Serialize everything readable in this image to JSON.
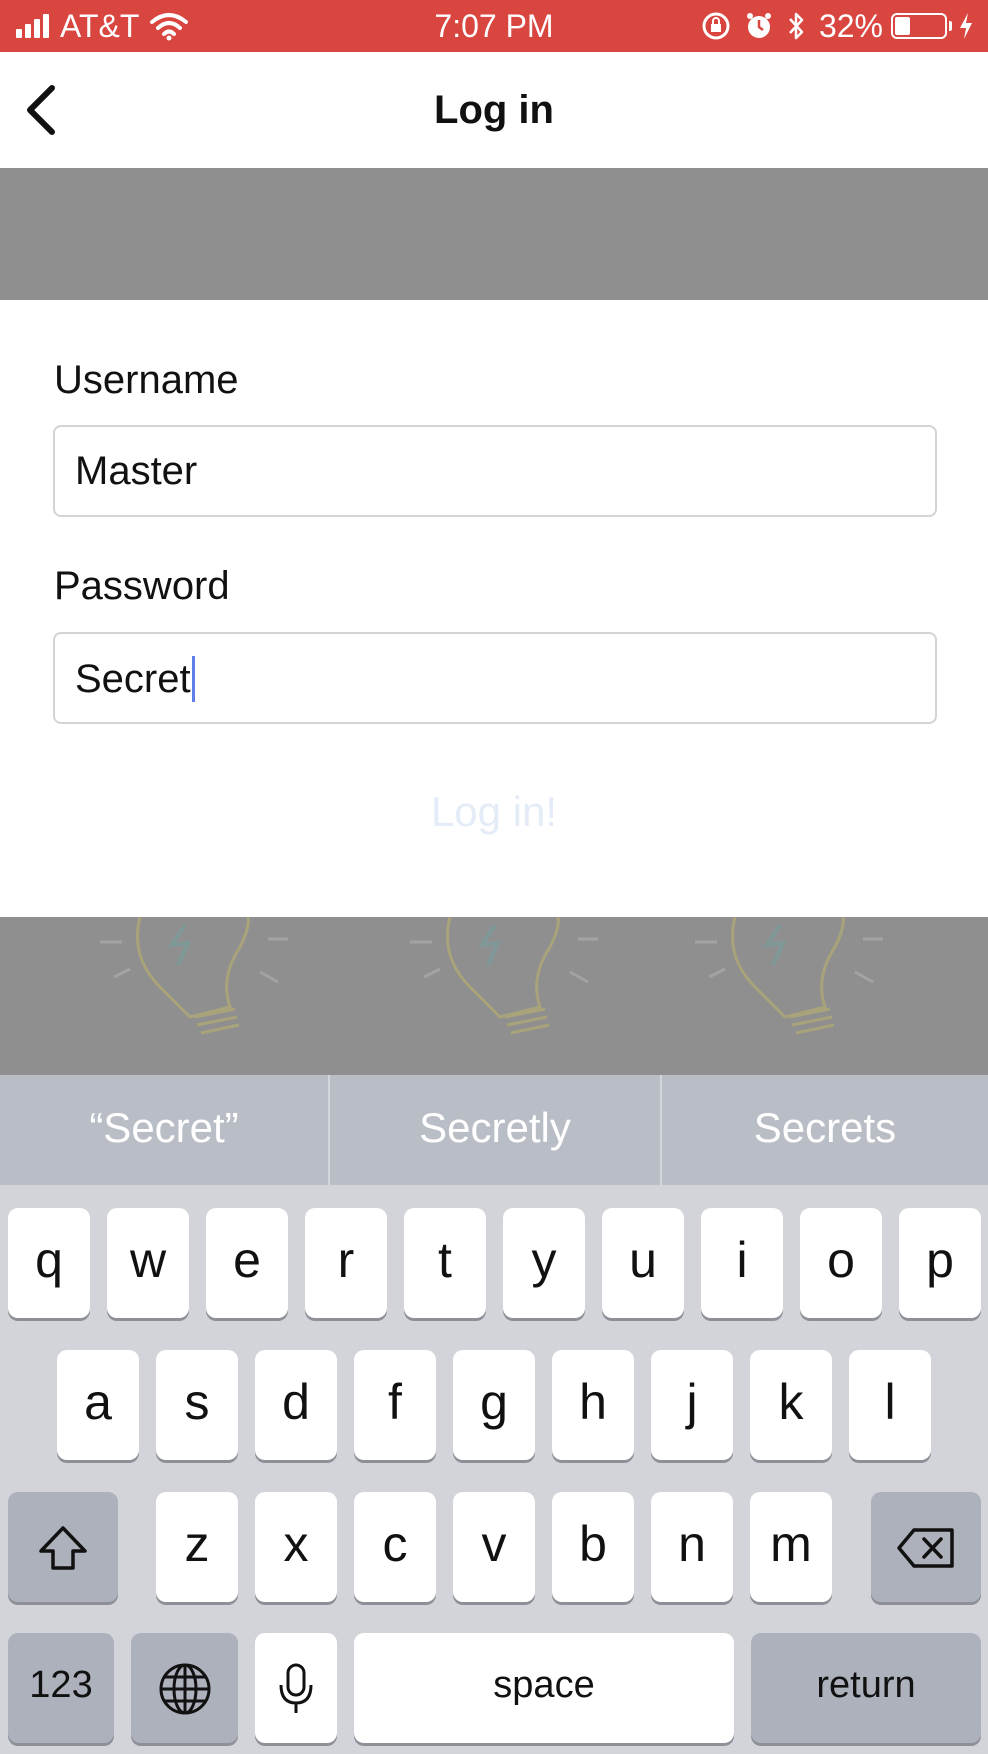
{
  "status_bar": {
    "carrier": "AT&T",
    "time": "7:07 PM",
    "battery_percent": "32%",
    "battery_level": 0.32,
    "background_color": "#d9453f"
  },
  "nav": {
    "title": "Log in",
    "back_icon": "chevron-left-icon"
  },
  "form": {
    "username_label": "Username",
    "username_value": "Master",
    "password_label": "Password",
    "password_value": "Secret",
    "submit_label": "Log in!"
  },
  "keyboard": {
    "suggestions": [
      "“Secret”",
      "Secretly",
      "Secrets"
    ],
    "row1": [
      "q",
      "w",
      "e",
      "r",
      "t",
      "y",
      "u",
      "i",
      "o",
      "p"
    ],
    "row2": [
      "a",
      "s",
      "d",
      "f",
      "g",
      "h",
      "j",
      "k",
      "l"
    ],
    "row3": [
      "z",
      "x",
      "c",
      "v",
      "b",
      "n",
      "m"
    ],
    "numbers_key": "123",
    "space_key": "space",
    "return_key": "return",
    "icons": {
      "shift": "shift-icon",
      "delete": "backspace-icon",
      "globe": "globe-icon",
      "mic": "microphone-icon"
    }
  }
}
